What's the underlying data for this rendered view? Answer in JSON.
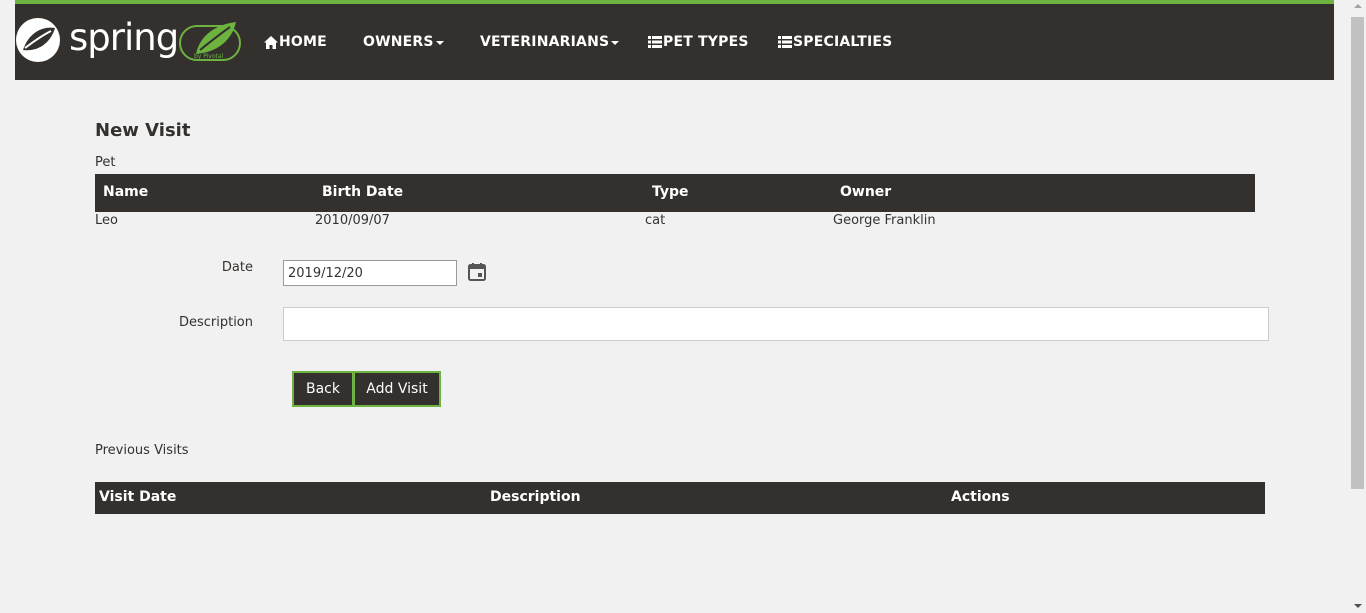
{
  "brand": {
    "name": "spring",
    "badge": "by Pivotal"
  },
  "nav": {
    "home": "HOME",
    "owners": "OWNERS",
    "veterinarians": "VETERINARIANS",
    "pet_types": "PET TYPES",
    "specialties": "SPECIALTIES"
  },
  "page": {
    "title": "New Visit",
    "pet_label": "Pet"
  },
  "pet_table": {
    "headers": [
      "Name",
      "Birth Date",
      "Type",
      "Owner"
    ],
    "row": [
      "Leo",
      "2010/09/07",
      "cat",
      "George Franklin"
    ]
  },
  "form": {
    "date_label": "Date",
    "date_value": "2019/12/20",
    "description_label": "Description",
    "description_value": "",
    "back_button": "Back",
    "add_button": "Add Visit"
  },
  "previous_visits": {
    "label": "Previous Visits",
    "headers": [
      "Visit Date",
      "Description",
      "Actions"
    ]
  },
  "colors": {
    "accent": "#6db33f",
    "dark": "#34302d",
    "background": "#f1f1f1"
  }
}
